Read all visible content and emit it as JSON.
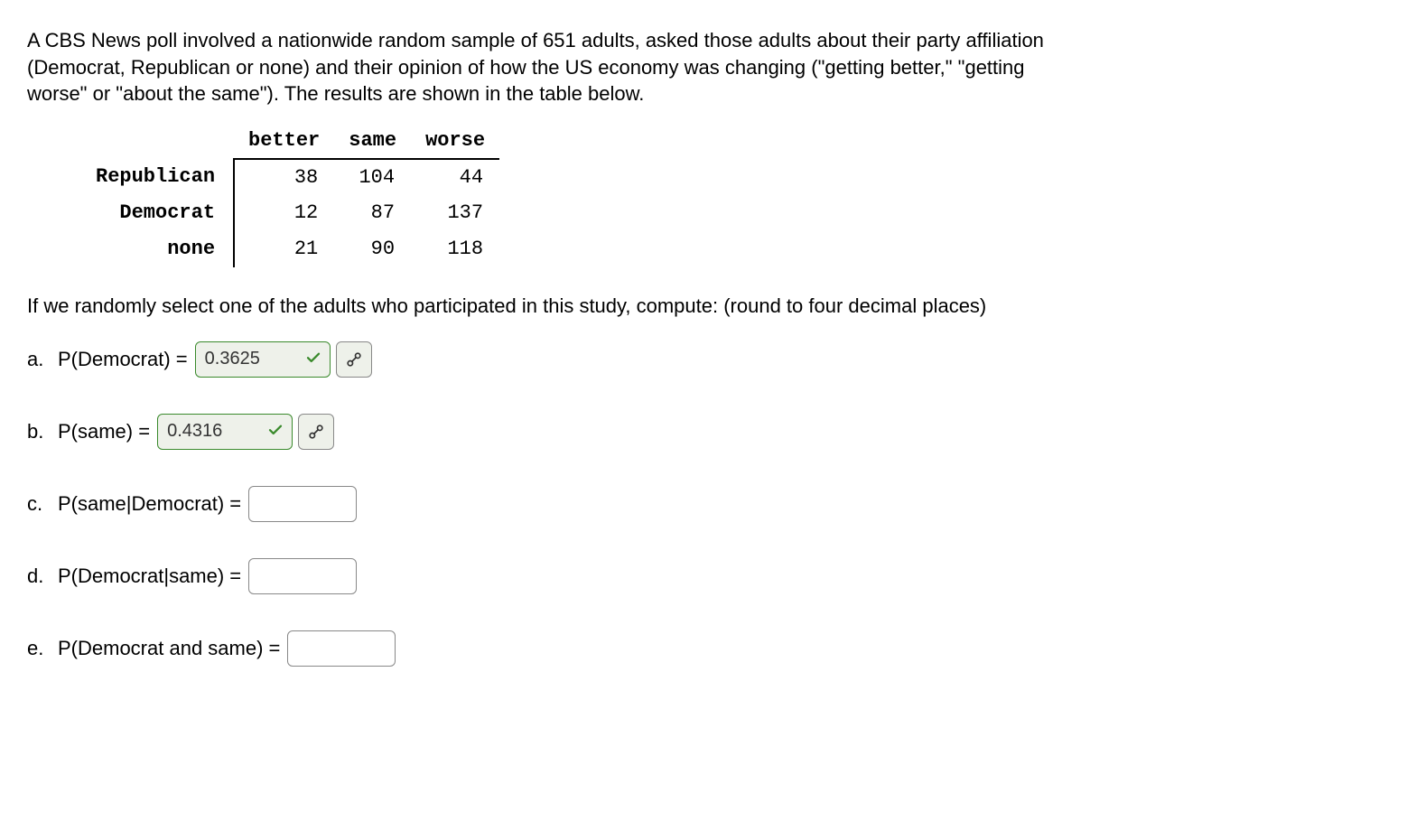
{
  "intro": "A CBS News poll involved a nationwide random sample of 651 adults, asked those adults about their party affiliation (Democrat, Republican or none) and their opinion of how the US economy was changing (\"getting better,\" \"getting worse\" or \"about the same\"). The results are shown in the table below.",
  "table": {
    "columns": [
      "better",
      "same",
      "worse"
    ],
    "rows": [
      {
        "label": "Republican",
        "values": [
          "38",
          "104",
          "44"
        ]
      },
      {
        "label": "Democrat",
        "values": [
          "12",
          "87",
          "137"
        ]
      },
      {
        "label": "none",
        "values": [
          "21",
          "90",
          "118"
        ]
      }
    ]
  },
  "instruction": "If we randomly select one of the adults who participated in this study, compute: (round to four decimal places)",
  "questions": {
    "a": {
      "letter": "a.",
      "text": "P(Democrat) =",
      "value": "0.3625",
      "correct": true
    },
    "b": {
      "letter": "b.",
      "text": "P(same) =",
      "value": "0.4316",
      "correct": true
    },
    "c": {
      "letter": "c.",
      "text": "P(same|Democrat) =",
      "value": "",
      "correct": false
    },
    "d": {
      "letter": "d.",
      "text": "P(Democrat|same) =",
      "value": "",
      "correct": false
    },
    "e": {
      "letter": "e.",
      "text": "P(Democrat and same) =",
      "value": "",
      "correct": false
    }
  },
  "icons": {
    "check": "check-icon",
    "retry": "retry-icon"
  }
}
